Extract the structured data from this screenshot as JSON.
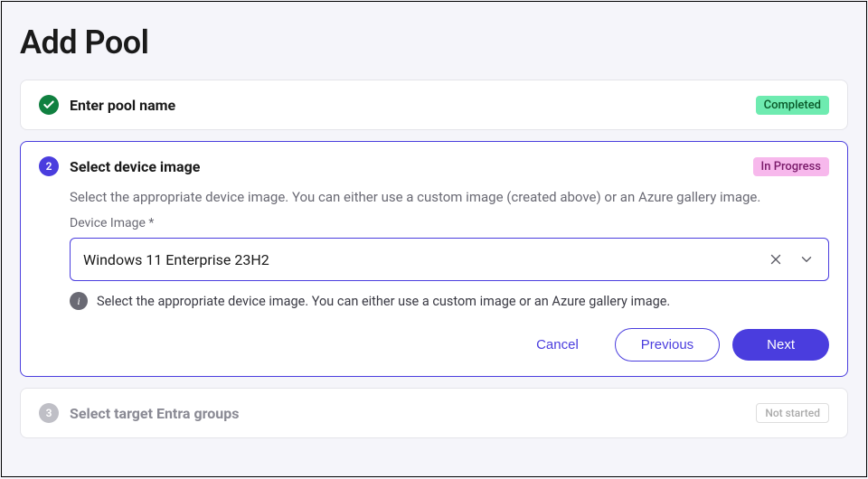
{
  "page_title": "Add Pool",
  "steps": {
    "step1": {
      "number": "1",
      "title": "Enter pool name",
      "status_label": "Completed"
    },
    "step2": {
      "number": "2",
      "title": "Select device image",
      "status_label": "In Progress",
      "description": "Select the appropriate device image. You can either use a custom image (created above) or an Azure gallery image.",
      "field_label": "Device Image *",
      "selected_value": "Windows 11 Enterprise 23H2",
      "hint": "Select the appropriate device image. You can either use a custom image or an Azure gallery image.",
      "buttons": {
        "cancel": "Cancel",
        "previous": "Previous",
        "next": "Next"
      }
    },
    "step3": {
      "number": "3",
      "title": "Select target Entra groups",
      "status_label": "Not started"
    }
  },
  "icons": {
    "info": "i"
  },
  "colors": {
    "primary": "#4a3dde",
    "success": "#108040",
    "success_bg": "#6eebb0",
    "progress_bg": "#f7b8ec"
  }
}
